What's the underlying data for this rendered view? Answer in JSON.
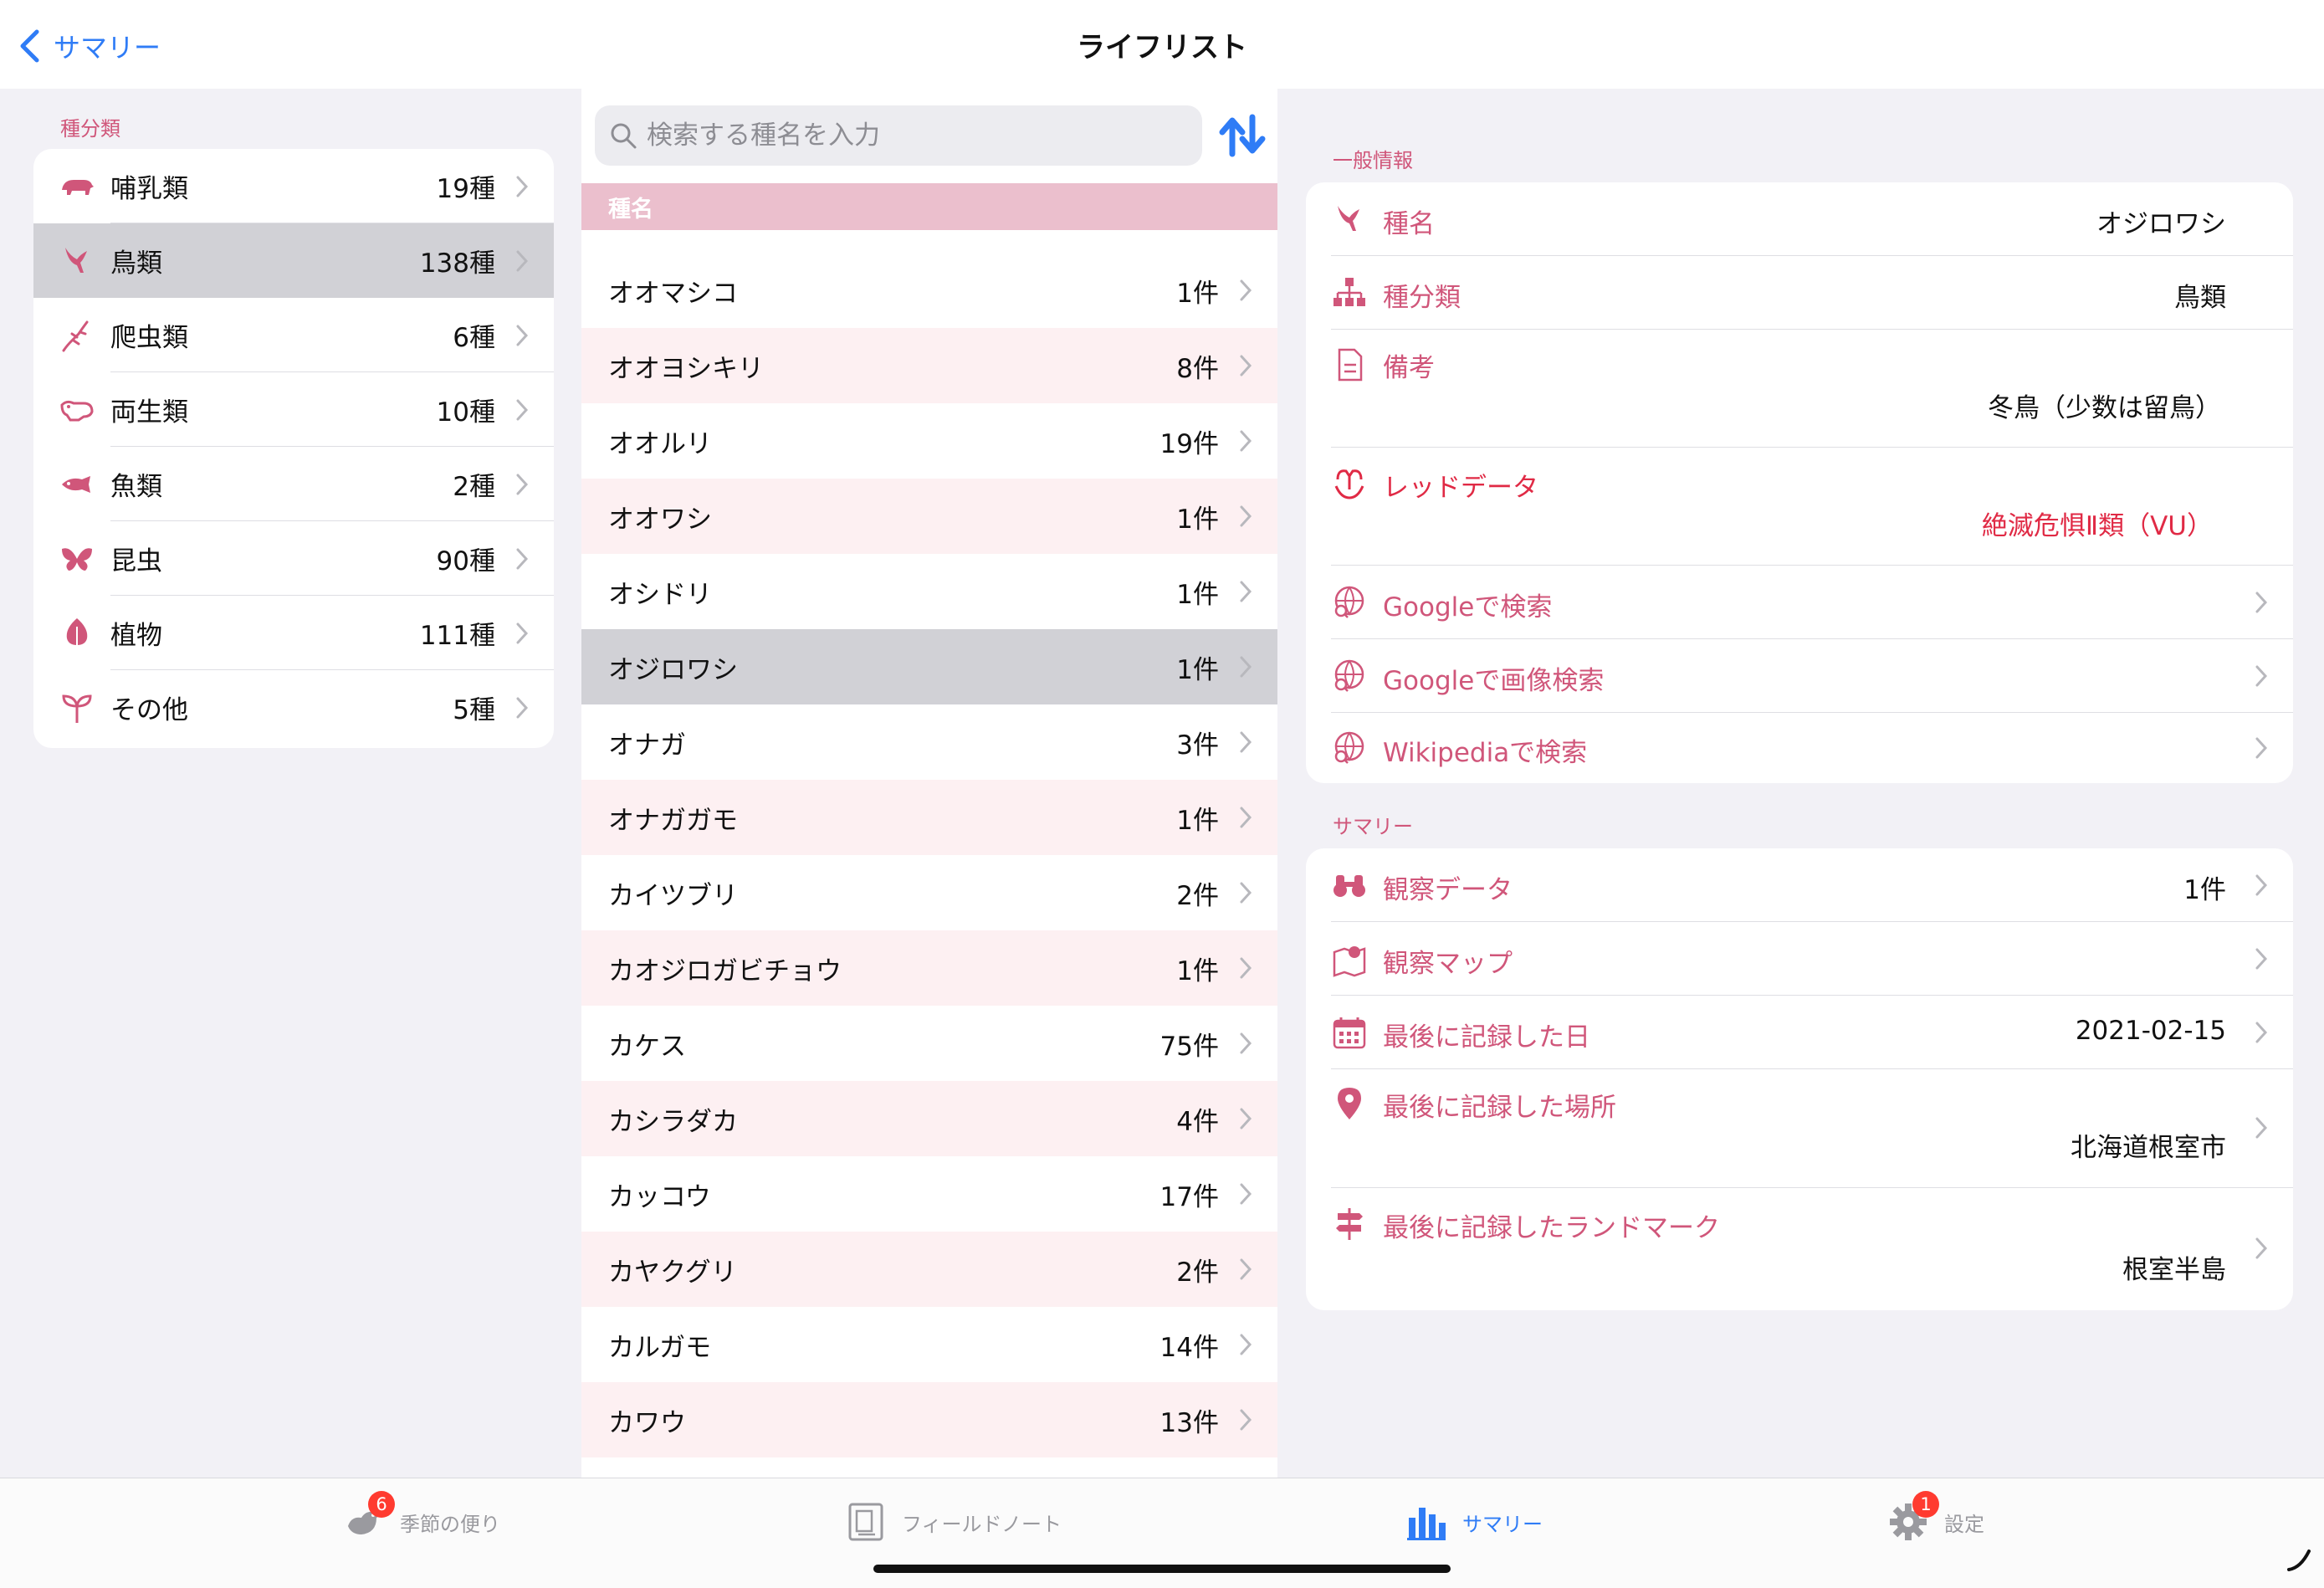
{
  "nav": {
    "back_label": "サマリー",
    "title": "ライフリスト"
  },
  "categories": {
    "section_label": "種分類",
    "items": [
      {
        "label": "哺乳類",
        "count": "19種",
        "icon": "mammal-icon"
      },
      {
        "label": "鳥類",
        "count": "138種",
        "icon": "bird-icon",
        "selected": true
      },
      {
        "label": "爬虫類",
        "count": "6種",
        "icon": "lizard-icon"
      },
      {
        "label": "両生類",
        "count": "10種",
        "icon": "frog-icon"
      },
      {
        "label": "魚類",
        "count": "2種",
        "icon": "fish-icon"
      },
      {
        "label": "昆虫",
        "count": "90種",
        "icon": "butterfly-icon"
      },
      {
        "label": "植物",
        "count": "111種",
        "icon": "leaf-icon"
      },
      {
        "label": "その他",
        "count": "5種",
        "icon": "sprout-icon"
      }
    ]
  },
  "species": {
    "search_placeholder": "検索する種名を入力",
    "header": "種名",
    "items": [
      {
        "name": "オオマシコ",
        "count": "1件"
      },
      {
        "name": "オオヨシキリ",
        "count": "8件"
      },
      {
        "name": "オオルリ",
        "count": "19件"
      },
      {
        "name": "オオワシ",
        "count": "1件"
      },
      {
        "name": "オシドリ",
        "count": "1件"
      },
      {
        "name": "オジロワシ",
        "count": "1件",
        "selected": true
      },
      {
        "name": "オナガ",
        "count": "3件"
      },
      {
        "name": "オナガガモ",
        "count": "1件"
      },
      {
        "name": "カイツブリ",
        "count": "2件"
      },
      {
        "name": "カオジロガビチョウ",
        "count": "1件"
      },
      {
        "name": "カケス",
        "count": "75件"
      },
      {
        "name": "カシラダカ",
        "count": "4件"
      },
      {
        "name": "カッコウ",
        "count": "17件"
      },
      {
        "name": "カヤクグリ",
        "count": "2件"
      },
      {
        "name": "カルガモ",
        "count": "14件"
      },
      {
        "name": "カワウ",
        "count": "13件"
      }
    ]
  },
  "general": {
    "section_label": "一般情報",
    "species_name_label": "種名",
    "species_name_value": "オジロワシ",
    "category_label": "種分類",
    "category_value": "鳥類",
    "note_label": "備考",
    "note_value": "冬鳥（少数は留鳥）",
    "red_data_label": "レッドデータ",
    "red_data_value": "絶滅危惧Ⅱ類（VU）",
    "google_search_label": "Googleで検索",
    "google_image_label": "Googleで画像検索",
    "wikipedia_label": "Wikipediaで検索"
  },
  "summary": {
    "section_label": "サマリー",
    "observation_label": "観察データ",
    "observation_value": "1件",
    "map_label": "観察マップ",
    "last_date_label": "最後に記録した日",
    "last_date_value": "2021-02-15",
    "last_place_label": "最後に記録した場所",
    "last_place_value": "北海道根室市",
    "last_landmark_label": "最後に記録したランドマーク",
    "last_landmark_value": "根室半島"
  },
  "tabs": [
    {
      "label": "季節の便り",
      "badge": "6"
    },
    {
      "label": "フィールドノート"
    },
    {
      "label": "サマリー",
      "active": true
    },
    {
      "label": "設定",
      "badge": "1"
    }
  ],
  "colors": {
    "accent": "#d0567a",
    "blue": "#2f7cf6",
    "red": "#e02a45",
    "header_pink": "#ebbfcd",
    "row_alt": "#fdf0f2"
  }
}
